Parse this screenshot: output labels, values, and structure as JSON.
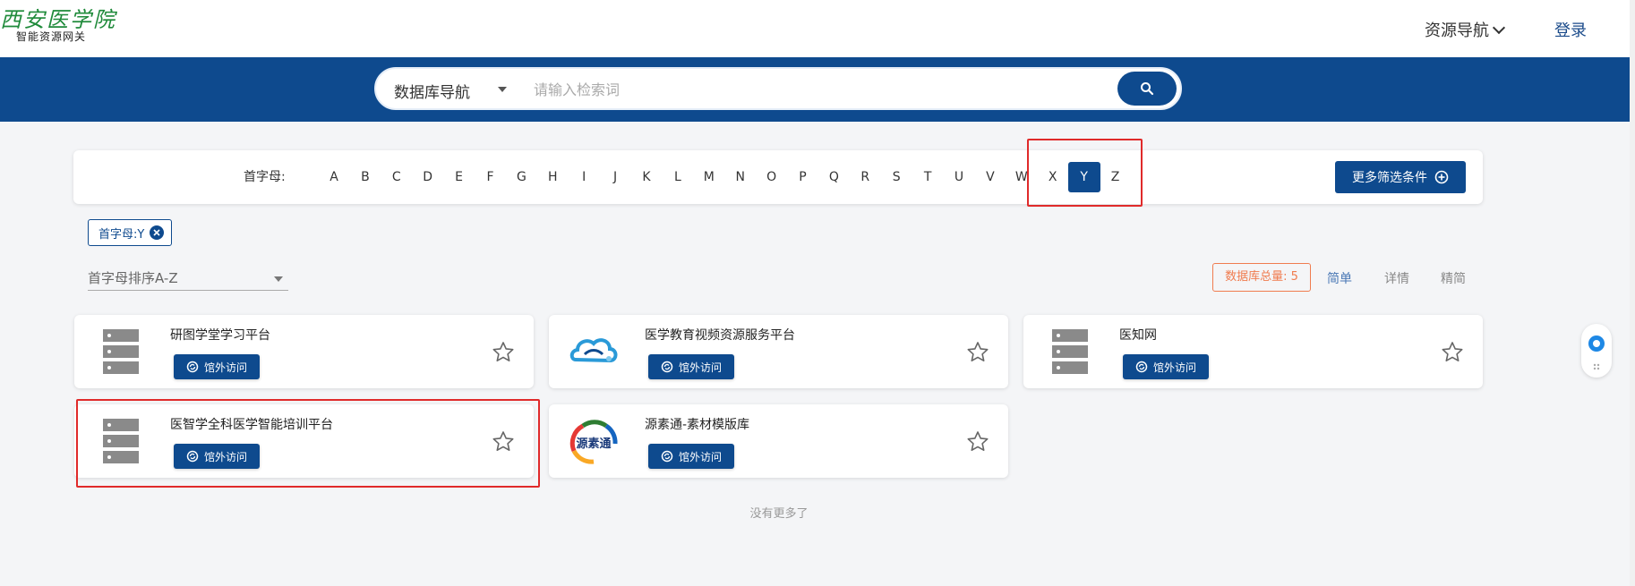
{
  "header": {
    "logo_text": "西安医学院",
    "logo_subtitle": "智能资源网关",
    "nav_resource": "资源导航",
    "nav_login": "登录"
  },
  "search": {
    "category": "数据库导航",
    "placeholder": "请输入检索词",
    "value": ""
  },
  "filter": {
    "label": "首字母:",
    "letters": [
      "A",
      "B",
      "C",
      "D",
      "E",
      "F",
      "G",
      "H",
      "I",
      "J",
      "K",
      "L",
      "M",
      "N",
      "O",
      "P",
      "Q",
      "R",
      "S",
      "T",
      "U",
      "V",
      "W",
      "X",
      "Y",
      "Z"
    ],
    "selected": "Y",
    "more_button": "更多筛选条件",
    "chip": "首字母:Y"
  },
  "toolbar": {
    "sort": "首字母排序A-Z",
    "total": "数据库总量: 5",
    "views": [
      "简单",
      "详情",
      "精简"
    ],
    "selected_view": "简单"
  },
  "cards": [
    {
      "title": "研图学堂学习平台",
      "visit": "馆外访问",
      "logo": "server-icon"
    },
    {
      "title": "医学教育视频资源服务平台",
      "visit": "馆外访问",
      "logo": "cloud-logo"
    },
    {
      "title": "医知网",
      "visit": "馆外访问",
      "logo": "server-icon"
    },
    {
      "title": "医智学全科医学智能培训平台",
      "visit": "馆外访问",
      "logo": "server-icon"
    },
    {
      "title": "源素通-素材模版库",
      "visit": "馆外访问",
      "logo": "yuansutong-logo",
      "logo_text": "源素通"
    }
  ],
  "footer": {
    "no_more": "没有更多了"
  },
  "colors": {
    "brand": "#0e4a8e",
    "accent": "#f07c4f",
    "highlight": "#e02a2a",
    "logo_green": "#1f8a3a"
  }
}
